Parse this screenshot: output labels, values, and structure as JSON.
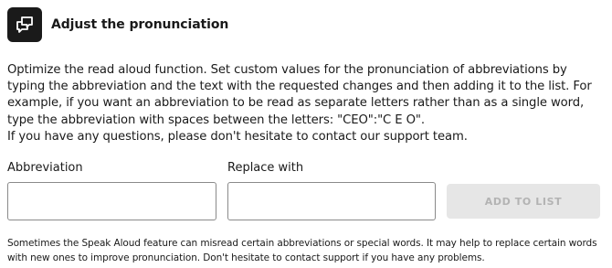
{
  "header": {
    "icon": "pronunciation-chat-icon",
    "title": "Adjust the pronunciation"
  },
  "description": {
    "paragraph_1": "Optimize the read aloud function. Set custom values for the pronunciation of abbreviations by typing the abbreviation and the text with the requested changes and then adding it to the list. For example, if you want an abbreviation to be read as separate letters rather than as a single word, type the abbreviation with spaces between the letters: \"CEO\":\"C E O\".",
    "paragraph_2": "If you have any questions, please don't hesitate to contact our support team."
  },
  "form": {
    "abbreviation_label": "Abbreviation",
    "abbreviation_value": "",
    "replace_label": "Replace with",
    "replace_value": "",
    "add_button_label": "ADD TO LIST",
    "add_button_state": "disabled"
  },
  "note": "Sometimes the Speak Aloud feature can misread certain abbreviations or special words. It may help to replace certain words with new ones to improve pronunciation. Don't hesitate to contact support if you have any problems.",
  "colors": {
    "icon_background": "#1a1a1a",
    "text": "#1a1a1a",
    "button_disabled_bg": "#e6e6e6",
    "button_disabled_text": "#b3b3b3",
    "input_border": "#8a8a8a"
  }
}
